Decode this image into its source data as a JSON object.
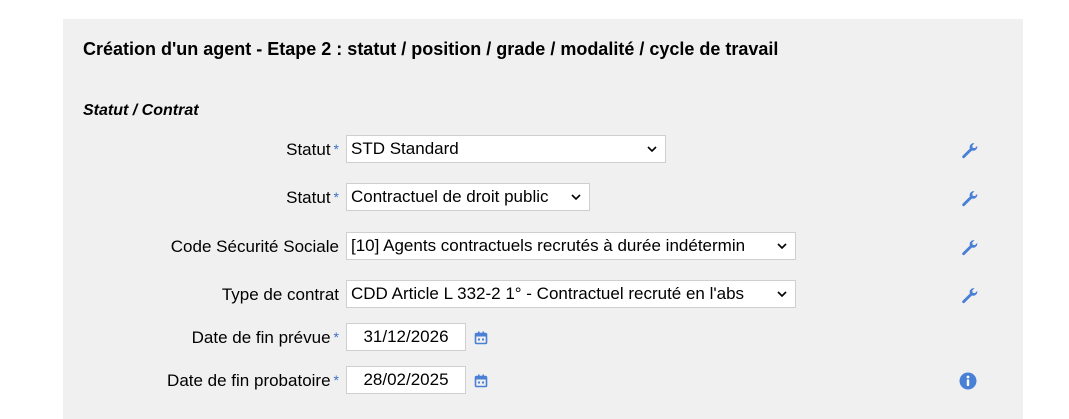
{
  "page": {
    "title": "Création d'un agent - Etape 2 : statut / position / grade / modalité / cycle de travail"
  },
  "section": {
    "title": "Statut / Contrat"
  },
  "required_marker": "*",
  "fields": {
    "statut1": {
      "label": "Statut",
      "value": "STD Standard"
    },
    "statut2": {
      "label": "Statut",
      "value": "Contractuel de droit public"
    },
    "code_secu": {
      "label": "Code Sécurité Sociale",
      "value": "[10] Agents contractuels recrutés à durée indétermin"
    },
    "type_contrat": {
      "label": "Type de contrat",
      "value": "CDD Article L 332-2 1° - Contractuel recruté en l'abs"
    },
    "date_fin_prevue": {
      "label": "Date de fin prévue",
      "value": "31/12/2026"
    },
    "date_fin_probatoire": {
      "label": "Date de fin probatoire",
      "value": "28/02/2025"
    }
  },
  "icons": {
    "wrench": "wrench-icon",
    "calendar": "calendar-icon",
    "info": "info-icon",
    "chevron": "chevron-down-icon"
  },
  "colors": {
    "required": "#3a6fd0",
    "icon_blue": "#4a7fd6",
    "panel_bg": "#f0f0f0"
  }
}
